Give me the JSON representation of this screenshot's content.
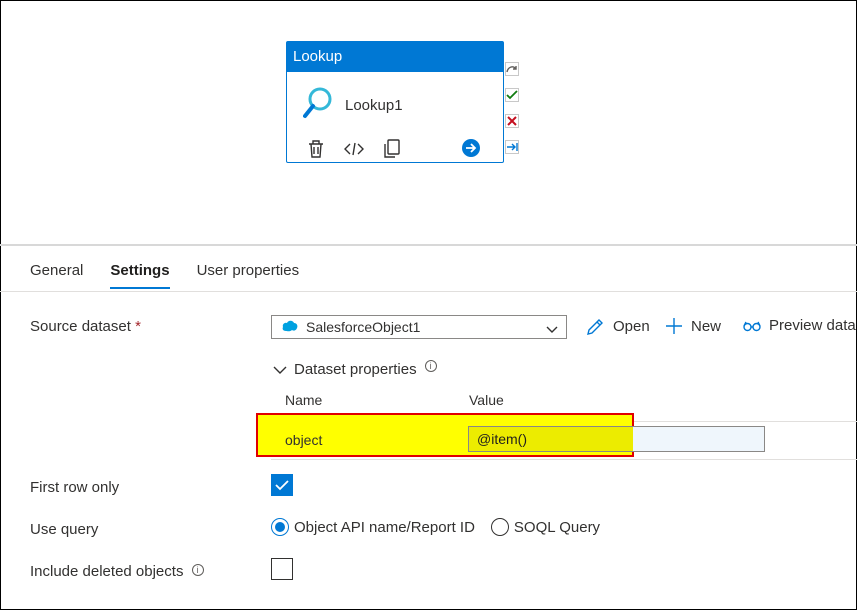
{
  "activity": {
    "type_title": "Lookup",
    "name": "Lookup1"
  },
  "tabs": [
    {
      "label": "General"
    },
    {
      "label": "Settings"
    },
    {
      "label": "User properties"
    }
  ],
  "settings": {
    "source_dataset_label": "Source dataset",
    "required_mark": "*",
    "source_dataset_value": "SalesforceObject1",
    "open_label": "Open",
    "new_label": "New",
    "preview_label": "Preview data",
    "dataset_properties_label": "Dataset properties",
    "info_glyph": "i",
    "name_col": "Name",
    "value_col": "Value",
    "property_name": "object",
    "property_value": "@item()",
    "first_row_only_label": "First row only",
    "use_query_label": "Use query",
    "query_option_1": "Object API name/Report ID",
    "query_option_2": "SOQL Query",
    "include_deleted_label": "Include deleted objects"
  },
  "colors": {
    "accent": "#0078d4",
    "highlight": "#ffff00",
    "highlight_border": "#e00000"
  }
}
